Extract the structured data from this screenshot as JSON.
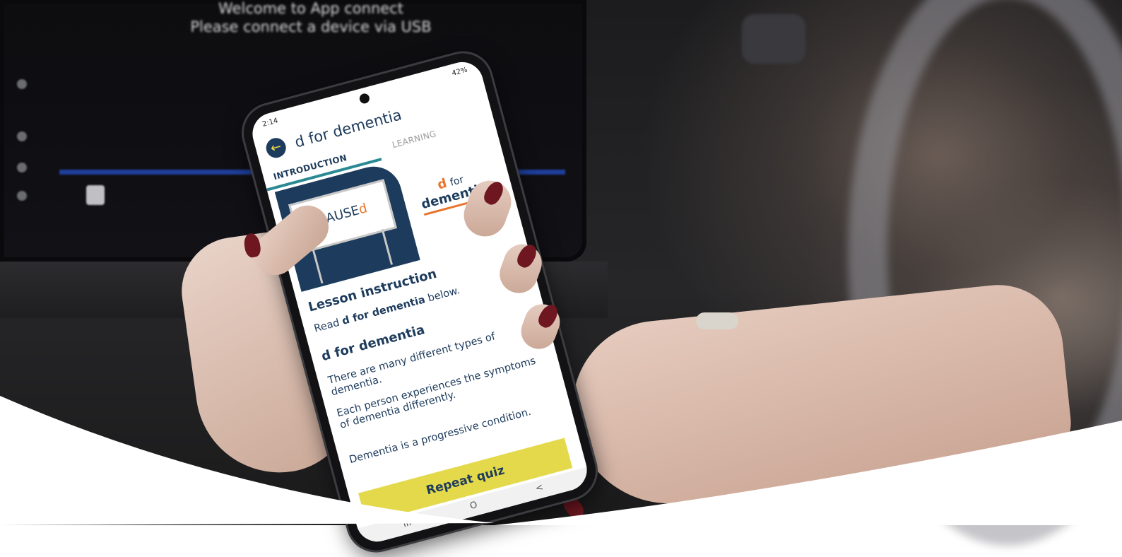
{
  "car_screen": {
    "line1": "Welcome to App connect",
    "line2": "Please connect a device via USB"
  },
  "phone": {
    "status": {
      "time": "2:14",
      "battery": "42%"
    },
    "title": "d for dementia",
    "tabs": [
      {
        "label": "INTRODUCTION",
        "active": true
      },
      {
        "label": "LEARNING",
        "active": false
      }
    ],
    "hero": {
      "board_text_main": "CAUSE",
      "board_text_accent": "d",
      "logo_d": "d",
      "logo_for": "for",
      "logo_word": "dementia"
    },
    "lesson_heading": "Lesson instruction",
    "lesson_text_pre": "Read",
    "lesson_text_bold": "d for dementia",
    "lesson_text_post": "below.",
    "section_heading": "d for dementia",
    "paragraphs": [
      "There are many different types of dementia.",
      "Each person experiences the symptoms of dementia differently.",
      "Dementia is a progressive condition."
    ],
    "cta_label": "Repeat quiz",
    "nav": {
      "recent": "III",
      "home": "O",
      "back": "<"
    }
  },
  "colors": {
    "brand_navy": "#1d3b5c",
    "accent_orange": "#e8742b",
    "cta_yellow": "#e3d94a",
    "tab_teal": "#2a8a93"
  }
}
